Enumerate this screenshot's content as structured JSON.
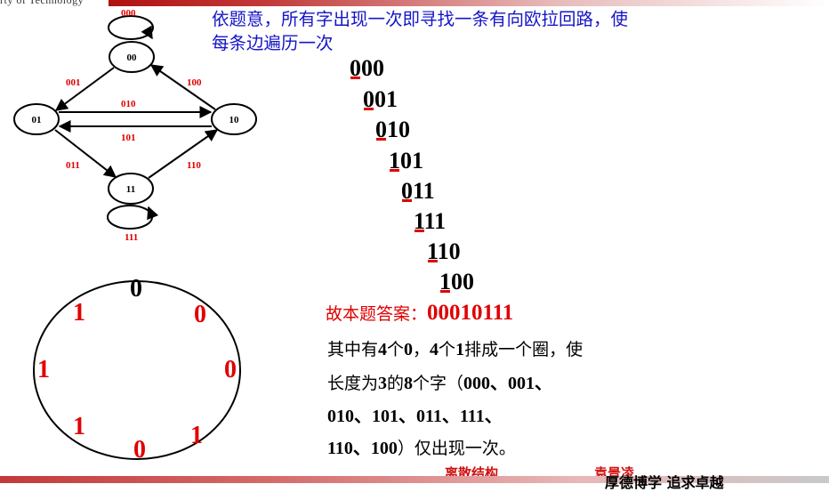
{
  "header": {
    "university_fragment": "rty of Technology"
  },
  "intro": {
    "line1": "依题意，所有字出现一次即寻找一条有向欧拉回路，使",
    "line2": "每条边遍历一次"
  },
  "graph": {
    "nodes": [
      {
        "id": "00",
        "label": "00"
      },
      {
        "id": "01",
        "label": "01"
      },
      {
        "id": "10",
        "label": "10"
      },
      {
        "id": "11",
        "label": "11"
      }
    ],
    "edge_labels": {
      "loop_00": "000",
      "e_00_01": "001",
      "e_10_00": "100",
      "e_01_10": "010",
      "e_10_01": "101",
      "e_01_11": "011",
      "e_11_10": "110",
      "loop_11": "111"
    },
    "colors": {
      "edge_label": "#e00000",
      "node_stroke": "#000000"
    }
  },
  "sequence": {
    "words": [
      "000",
      "001",
      "010",
      "101",
      "011",
      "111",
      "110",
      "100"
    ],
    "underline_color": "#e00000"
  },
  "cycle": {
    "digits": [
      "0",
      "0",
      "0",
      "0",
      "1",
      "1",
      "1",
      "1"
    ],
    "colors": {
      "zero": "#000000",
      "rest": "#e00000"
    }
  },
  "answer": {
    "label": "故本题答案：",
    "value": "00010111"
  },
  "explanation": {
    "l1_a": "其中有",
    "l1_b": "4",
    "l1_c": "个",
    "l1_d": "0",
    "l1_e": "，",
    "l1_f": "4",
    "l1_g": "个",
    "l1_h": "1",
    "l1_i": "排成一个圈，使",
    "l2_a": "长度为",
    "l2_b": "3",
    "l2_c": "的",
    "l2_d": "8",
    "l2_e": "个字（",
    "l2_f": "000、001、",
    "l3": "010、101、011、111、",
    "l4_a": "110、100",
    "l4_b": "）仅出现一次。"
  },
  "footer": {
    "course": "离散结构",
    "author": "袁景凌",
    "slogan": "厚德博学  追求卓越"
  }
}
